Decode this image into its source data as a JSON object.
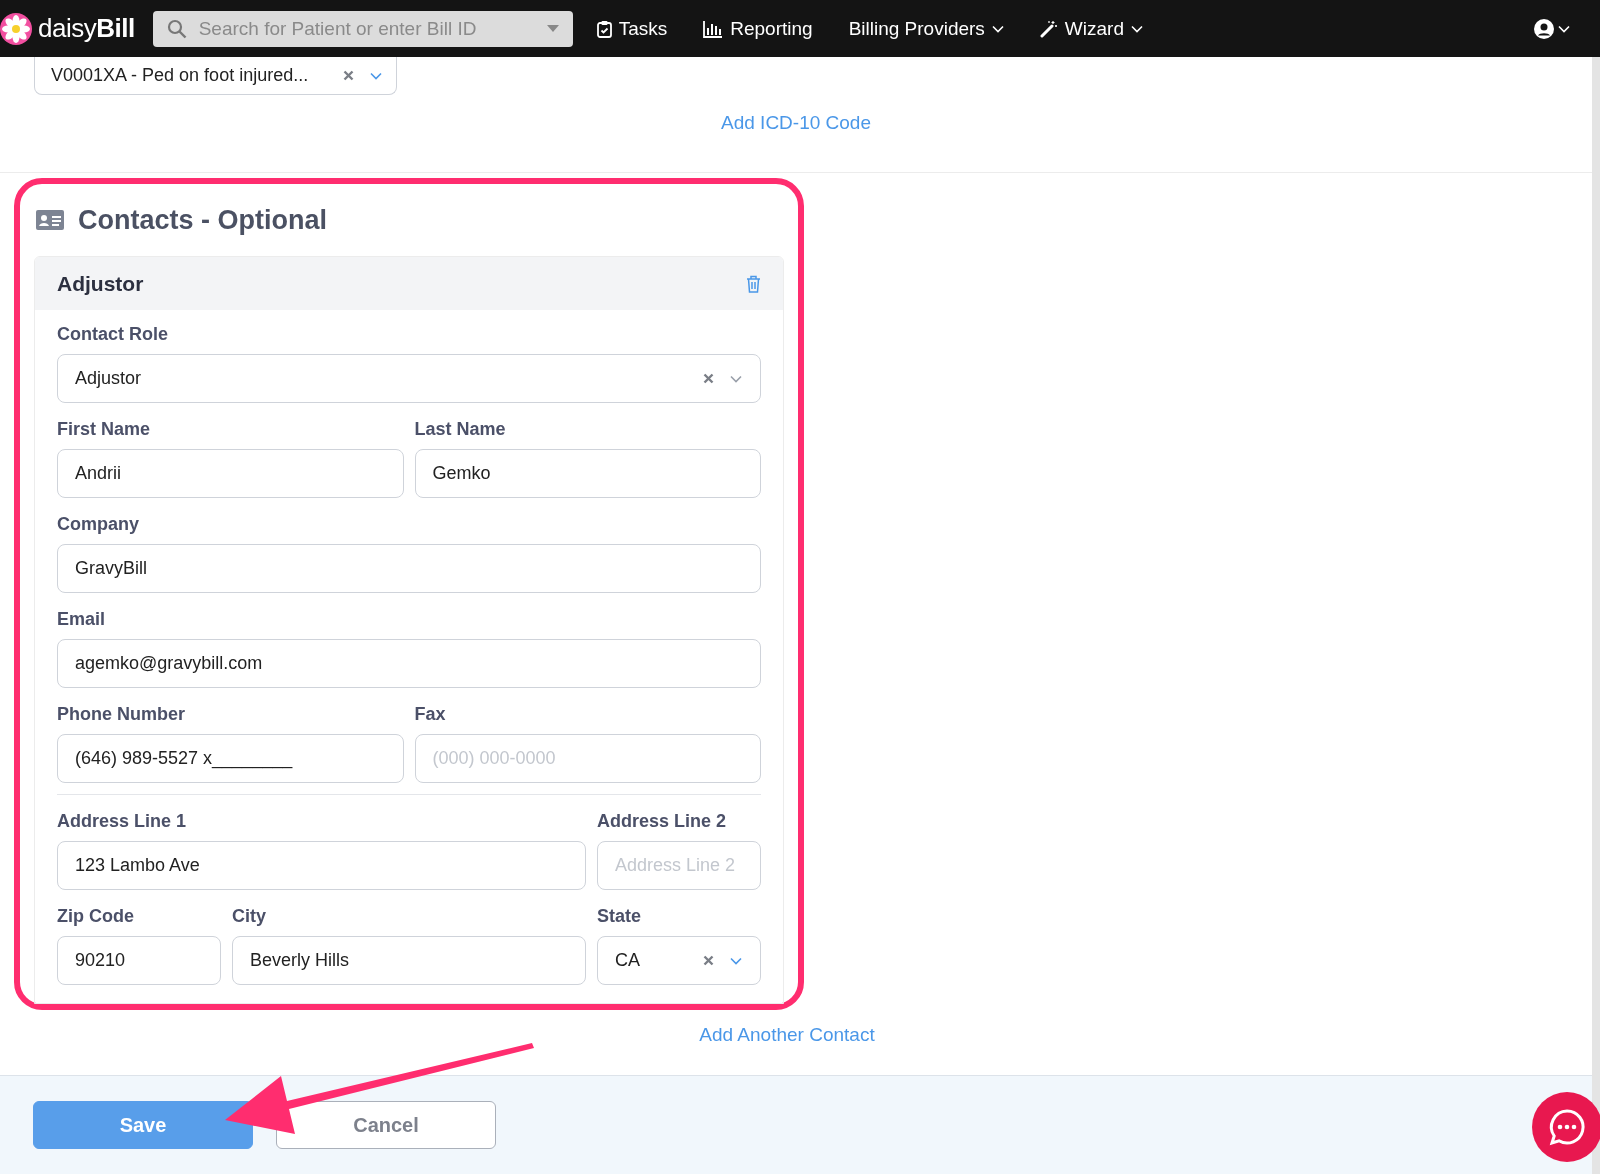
{
  "nav": {
    "logo_light": "daisy",
    "logo_bold": "Bill",
    "search_placeholder": "Search for Patient or enter Bill ID",
    "items": [
      {
        "label": "Tasks",
        "dropdown": false
      },
      {
        "label": "Reporting",
        "dropdown": false
      },
      {
        "label": "Billing Providers",
        "dropdown": true
      },
      {
        "label": "Wizard",
        "dropdown": true
      }
    ]
  },
  "icd": {
    "value": "V0001XA - Ped on foot injured...",
    "add_link": "Add ICD-10 Code"
  },
  "contacts": {
    "title": "Contacts - Optional",
    "cards": [
      {
        "title": "Adjustor",
        "rows": [
          {
            "divider": false,
            "fields": [
              {
                "label": "Contact Role",
                "kind": "select",
                "value": "Adjustor"
              }
            ]
          },
          {
            "divider": false,
            "fields": [
              {
                "label": "First Name",
                "kind": "text",
                "value": "Andrii"
              },
              {
                "label": "Last Name",
                "kind": "text",
                "value": "Gemko"
              }
            ]
          },
          {
            "divider": false,
            "fields": [
              {
                "label": "Company",
                "kind": "text",
                "value": "GravyBill"
              }
            ]
          },
          {
            "divider": false,
            "fields": [
              {
                "label": "Email",
                "kind": "text",
                "value": "agemko@gravybill.com"
              }
            ]
          },
          {
            "divider": true,
            "fields": [
              {
                "label": "Phone Number",
                "kind": "text",
                "value": "(646) 989-5527 x________"
              },
              {
                "label": "Fax",
                "kind": "text",
                "placeholder": "(000) 000-0000"
              }
            ]
          },
          {
            "divider": false,
            "fields": [
              {
                "label": "Address Line 1",
                "kind": "text",
                "value": "123 Lambo Ave"
              },
              {
                "label": "Address Line 2",
                "kind": "text",
                "placeholder": "Address Line 2"
              }
            ]
          },
          {
            "divider": false,
            "fields": [
              {
                "label": "Zip Code",
                "kind": "text",
                "value": "90210"
              },
              {
                "label": "City",
                "kind": "text",
                "value": "Beverly Hills"
              },
              {
                "label": "State",
                "kind": "select",
                "value": "CA"
              }
            ]
          }
        ]
      }
    ],
    "add_link": "Add Another Contact"
  },
  "footer": {
    "buttons": [
      {
        "label": "Save",
        "kind": "primary"
      },
      {
        "label": "Cancel",
        "kind": "secondary"
      }
    ]
  }
}
